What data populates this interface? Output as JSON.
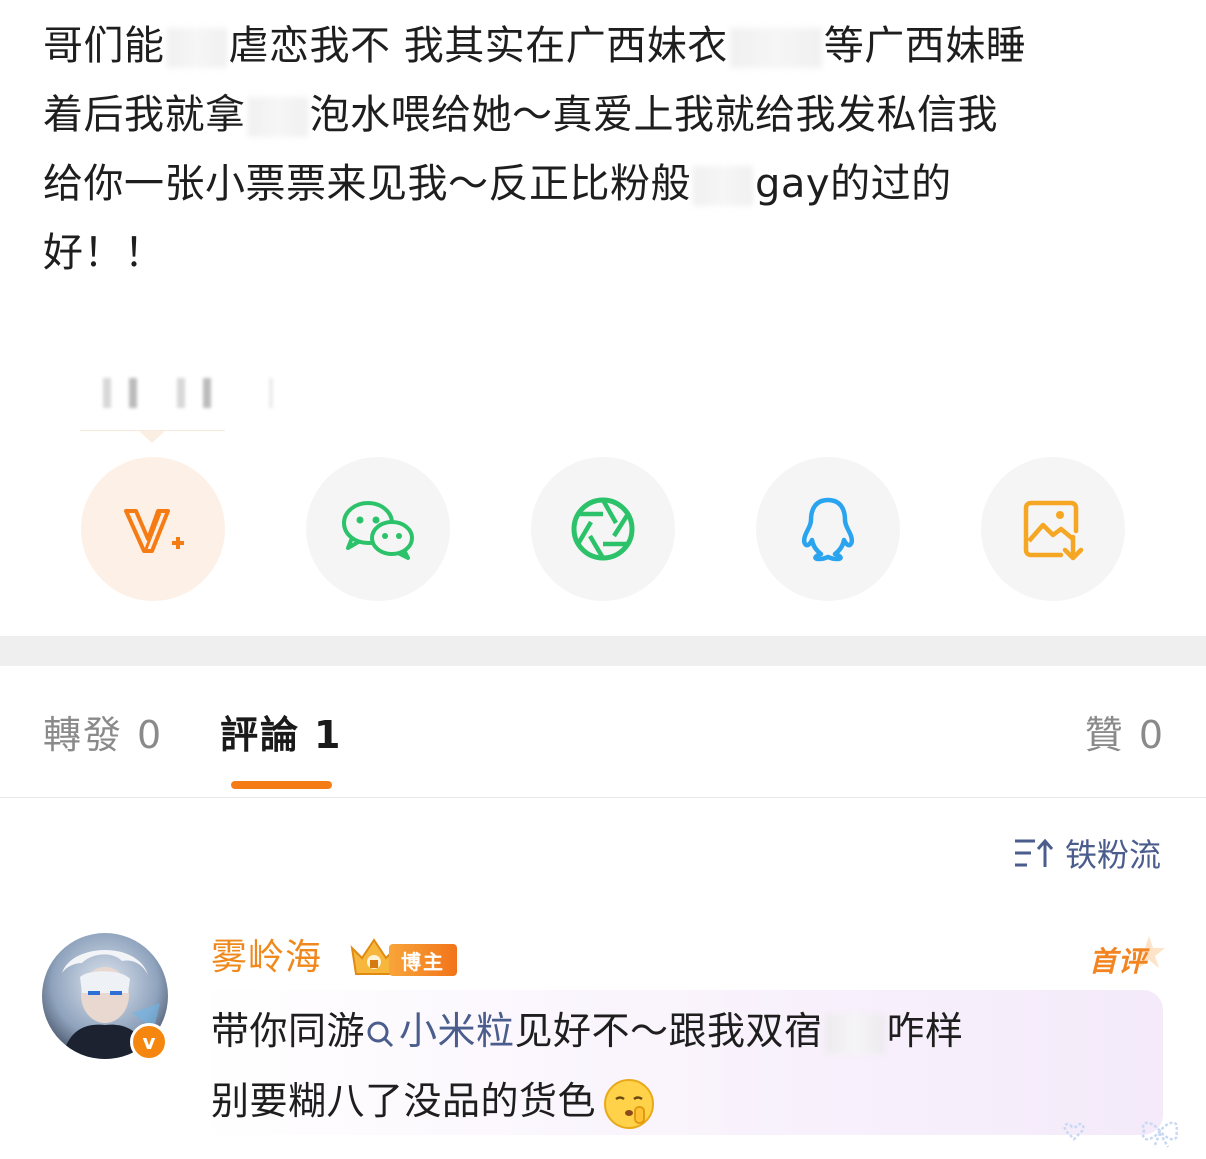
{
  "post": {
    "line1_a": "哥们能",
    "line1_b": "虐恋我不 我其实在广西妹衣",
    "line1_c": "等广西妹睡",
    "line2_a": "着后我就拿",
    "line2_b": "泡水喂给她～真爱上我就给我发私信我",
    "line3_a": "给你一张小票票来见我～反正比粉般",
    "line3_b": "gay的过的",
    "line4": "好！！"
  },
  "share": {
    "items": [
      "v-plus-icon",
      "wechat-icon",
      "moments-icon",
      "qq-icon",
      "save-image-icon"
    ]
  },
  "tabs": {
    "repost_label": "轉發",
    "repost_count": "0",
    "comment_label": "評論",
    "comment_count": "1",
    "like_label": "贊",
    "like_count": "0"
  },
  "sort": {
    "label": "铁粉流"
  },
  "comment": {
    "username": "雾岭海",
    "role_badge": "博主",
    "first_badge": "首评",
    "text_a": "带你同游",
    "topic": "小米粒",
    "text_b": "见好不～跟我双宿",
    "text_c": "咋样",
    "line2": "别要糊八了没品的货色"
  },
  "colors": {
    "accent": "#f57c14",
    "username": "#f0891d",
    "link": "#4a5d8c",
    "wechat": "#2cc26a",
    "qq": "#2ba4f0"
  }
}
